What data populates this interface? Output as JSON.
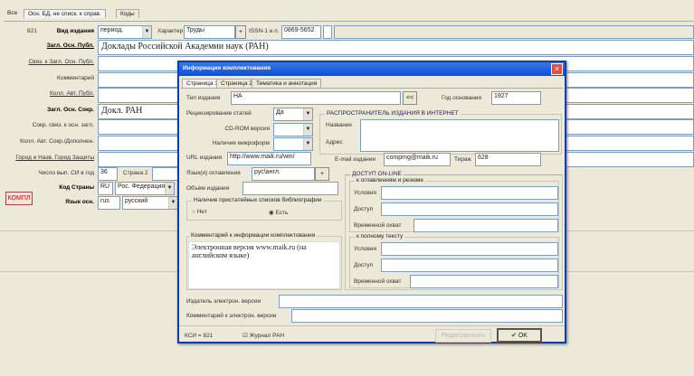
{
  "main": {
    "tabs": [
      "Все",
      "Осн. БД, не списк. к справ.",
      "Коды"
    ],
    "record_no": "821",
    "type_label": "Вид издания",
    "type_value": "период.",
    "character_label": "Характер",
    "character_value": "Труды",
    "plus": "+",
    "issn_label": "ISSN-1 и.п.",
    "issn_value": "0869-5652",
    "rows": [
      {
        "label": "Загл. Осн. Публ.",
        "value": "Доклады Российской Академии наук (РАН)"
      },
      {
        "label": "Связ. к Загл. Осн. Публ.",
        "value": ""
      },
      {
        "label": "Комментарий",
        "value": ""
      },
      {
        "label": "Колл. Авт. Публ.",
        "value": ""
      },
      {
        "label": "Загл. Осн. Сокр.",
        "value": "Докл. РАН"
      },
      {
        "label": "Сокр. связ. к осн. загл.",
        "value": ""
      },
      {
        "label": "Колл. Авт. Сокр./Дополнен.",
        "value": ""
      },
      {
        "label": "Город и Назв. Город Защиты",
        "value": ""
      }
    ],
    "issues_label": "Число вып. СИ в год",
    "issues_value": "36",
    "country2_label": "Страна 2",
    "country_code_label": "Код Страны",
    "country_code": "RU",
    "country_name": "Рос. Федерация",
    "compl_button": "КОМПЛ",
    "lang_label": "Язык осн.",
    "lang_code": "rus",
    "lang_name": "русский"
  },
  "dialog": {
    "title": "Информация комплектования",
    "close": "×",
    "tabs": [
      "Страница 1",
      "Страница 2",
      "Тематика и аннотация"
    ],
    "pub_type_label": "Тип издания",
    "pub_type_value": "НА",
    "back_button": "<<",
    "year_label": "Год основания",
    "year_value": "1927",
    "review_label": "Рецензирование статей",
    "review_value": "Да",
    "cdrom_label": "CD-ROM версия",
    "micro_label": "Наличие микроформ",
    "distributor_group": "РАСПРОСТРАНИТЕЛЬ ИЗДАНИЯ В ИНТЕРНЕТ",
    "name_label": "Название",
    "address_label": "Адрес",
    "url_label": "URL издания",
    "url_value": "http://www.maik.ru/win/",
    "email_label": "E-mail издания",
    "email_value": "compmg@maik.ru",
    "circ_label": "Тираж",
    "circ_value": "628",
    "lang_label": "Язык(и) оглавления",
    "lang_value": "рус\\англ.",
    "plus": "+",
    "volume_label": "Объём издания",
    "biblio_group": "Наличие пристатейных списков библиографии",
    "radio_no": "Нет",
    "radio_yes": "Есть",
    "comment_group": "Комментарий к информации комплектования",
    "comment_value": "Электронная версия  www.maik.ru (на английском языке)",
    "online_group": "ДОСТУП ON-LINE",
    "toc_group": "к оглавлениям и резюме",
    "full_group": "к полному тексту",
    "cond_label": "Условия",
    "access_label": "Доступ",
    "time_label": "Временной охват",
    "epub_label": "Издатель электрон. версии",
    "ecomment_label": "Комментарий к электрон. версии",
    "ksi": "КСИ = 821",
    "journal_check": "Журнал РАН",
    "edit_button": "Редактировать",
    "ok_button": "OK"
  }
}
